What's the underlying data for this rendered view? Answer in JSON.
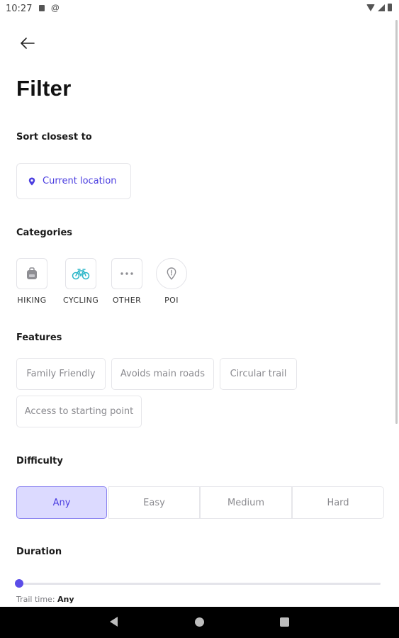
{
  "status_bar": {
    "time": "10:27"
  },
  "title": "Filter",
  "sort": {
    "label": "Sort closest to",
    "location_button": "Current location"
  },
  "categories": {
    "label": "Categories",
    "items": [
      {
        "label": "HIKING",
        "icon": "backpack-icon"
      },
      {
        "label": "CYCLING",
        "icon": "bicycle-icon",
        "color": "#2bb6c8"
      },
      {
        "label": "OTHER",
        "icon": "more-dots-icon"
      },
      {
        "label": "POI",
        "icon": "poi-pin-icon"
      }
    ]
  },
  "features": {
    "label": "Features",
    "chips": [
      "Family Friendly",
      "Avoids main roads",
      "Circular trail",
      "Access to starting point"
    ]
  },
  "difficulty": {
    "label": "Difficulty",
    "options": [
      "Any",
      "Easy",
      "Medium",
      "Hard"
    ],
    "selected": "Any"
  },
  "duration": {
    "label": "Duration",
    "trail_time_label": "Trail time:",
    "trail_time_value": "Any"
  },
  "colors": {
    "accent": "#4b3ee0",
    "selected_bg": "#dcdaff",
    "cycling": "#2bb6c8"
  }
}
